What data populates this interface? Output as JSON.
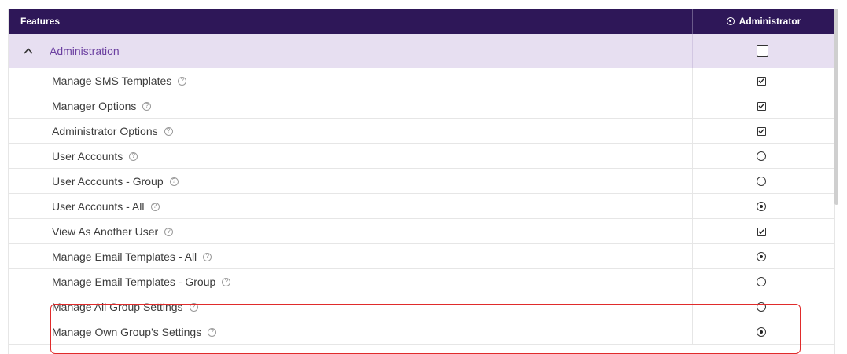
{
  "header": {
    "features_label": "Features",
    "role_label": "Administrator"
  },
  "group": {
    "label": "Administration",
    "expanded": true,
    "checked": false
  },
  "rows": [
    {
      "label": "Manage SMS Templates",
      "control": "checkbox",
      "checked": true
    },
    {
      "label": "Manager Options",
      "control": "checkbox",
      "checked": true
    },
    {
      "label": "Administrator Options",
      "control": "checkbox",
      "checked": true
    },
    {
      "label": "User Accounts",
      "control": "radio",
      "checked": false
    },
    {
      "label": "User Accounts - Group",
      "control": "radio",
      "checked": false
    },
    {
      "label": "User Accounts - All",
      "control": "radio",
      "checked": true
    },
    {
      "label": "View As Another User",
      "control": "checkbox",
      "checked": true
    },
    {
      "label": "Manage Email Templates - All",
      "control": "radio",
      "checked": true
    },
    {
      "label": "Manage Email Templates - Group",
      "control": "radio",
      "checked": false
    },
    {
      "label": "Manage All Group Settings",
      "control": "radio",
      "checked": false
    },
    {
      "label": "Manage Own Group's Settings",
      "control": "radio",
      "checked": true
    }
  ],
  "colors": {
    "header_bg": "#2e1758",
    "group_bg": "#e7dff1",
    "accent": "#6b3fa0",
    "highlight": "#e02b2b"
  }
}
